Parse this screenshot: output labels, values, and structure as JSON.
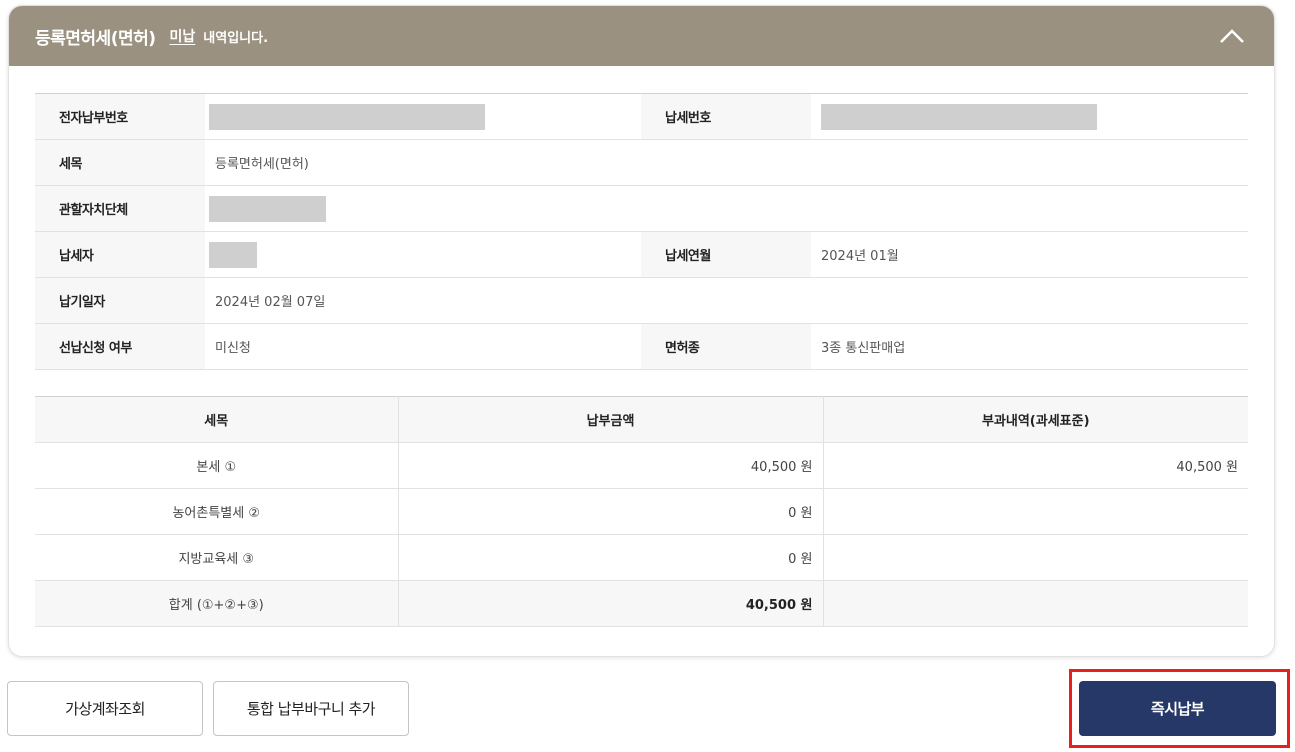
{
  "header": {
    "title": "등록면허세(면허)",
    "status": "미납",
    "suffix": "내역입니다.",
    "collapse_icon": "chevron-up-icon"
  },
  "info": {
    "electronic_payment_no": {
      "label": "전자납부번호",
      "value": ""
    },
    "tax_no": {
      "label": "납세번호",
      "value": ""
    },
    "tax_item": {
      "label": "세목",
      "value": "등록면허세(면허)"
    },
    "local_gov": {
      "label": "관할자치단체",
      "value": ""
    },
    "taxpayer": {
      "label": "납세자",
      "value": ""
    },
    "tax_year_month": {
      "label": "납세연월",
      "value": "2024년 01월"
    },
    "due_date": {
      "label": "납기일자",
      "value": "2024년 02월 07일"
    },
    "prepay": {
      "label": "선납신청 여부",
      "value": "미신청"
    },
    "license_class": {
      "label": "면허종",
      "value": "3종 통신판매업"
    }
  },
  "amounts": {
    "headers": [
      "세목",
      "납부금액",
      "부과내역(과세표준)"
    ],
    "rows": [
      {
        "name": "본세 ①",
        "amount": "40,500 원",
        "assessed": "40,500 원"
      },
      {
        "name": "농어촌특별세 ②",
        "amount": "0 원",
        "assessed": ""
      },
      {
        "name": "지방교육세 ③",
        "amount": "0 원",
        "assessed": ""
      }
    ],
    "total": {
      "name": "합계 (①+②+③)",
      "amount": "40,500 원",
      "assessed": ""
    }
  },
  "buttons": {
    "virtual_account": "가상계좌조회",
    "add_basket": "통합 납부바구니 추가",
    "pay_now": "즉시납부"
  },
  "colors": {
    "header_bg": "#9b9181",
    "pay_button": "#253868",
    "highlight": "#e8201b"
  }
}
